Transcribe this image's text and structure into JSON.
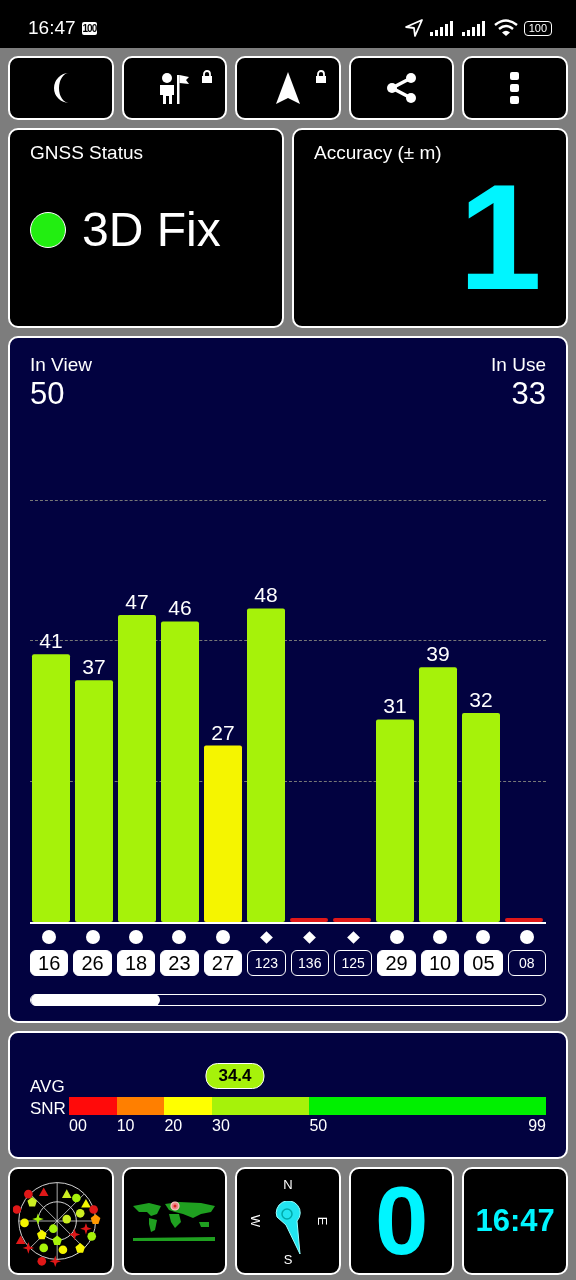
{
  "status_bar": {
    "time": "16:47",
    "badge": "100",
    "battery": "100"
  },
  "toolbar": [
    {
      "kind": "moon",
      "locked": false
    },
    {
      "kind": "person-flag",
      "locked": true
    },
    {
      "kind": "arrow",
      "locked": true
    },
    {
      "kind": "share",
      "locked": false
    },
    {
      "kind": "more",
      "locked": false
    }
  ],
  "gnss_status": {
    "title": "GNSS Status",
    "value": "3D Fix",
    "color": "#22ee11"
  },
  "accuracy": {
    "title": "Accuracy (± m)",
    "value": "1"
  },
  "satellites_panel": {
    "in_view_label": "In View",
    "in_view": "50",
    "in_use_label": "In Use",
    "in_use": "33",
    "chart_data": {
      "type": "bar",
      "categories": [
        "16",
        "26",
        "18",
        "23",
        "27",
        "123",
        "136",
        "125",
        "29",
        "10",
        "05",
        "08"
      ],
      "values": [
        41,
        37,
        47,
        46,
        27,
        48,
        0,
        0,
        31,
        39,
        32,
        0
      ],
      "value_labels": [
        "41",
        "37",
        "47",
        "46",
        "27",
        "48",
        null,
        null,
        "31",
        "39",
        "32",
        null
      ]
    },
    "satellites": [
      {
        "color": "#a6f20a",
        "used": true,
        "kind": "circle"
      },
      {
        "color": "#a6f20a",
        "used": true,
        "kind": "circle"
      },
      {
        "color": "#a6f20a",
        "used": true,
        "kind": "circle"
      },
      {
        "color": "#a6f20a",
        "used": true,
        "kind": "circle"
      },
      {
        "color": "#f5f500",
        "used": true,
        "kind": "circle"
      },
      {
        "color": "#a6f20a",
        "used": false,
        "kind": "diamond"
      },
      {
        "color": "#e01818",
        "used": false,
        "kind": "diamond"
      },
      {
        "color": "#e01818",
        "used": false,
        "kind": "diamond"
      },
      {
        "color": "#a6f20a",
        "used": true,
        "kind": "circle"
      },
      {
        "color": "#a6f20a",
        "used": true,
        "kind": "circle"
      },
      {
        "color": "#a6f20a",
        "used": true,
        "kind": "circle"
      },
      {
        "color": "#e01818",
        "used": false,
        "kind": "circle"
      }
    ]
  },
  "snr": {
    "label_1": "AVG",
    "label_2": "SNR",
    "value": "34.4",
    "level": 0.348,
    "segments": [
      {
        "color": "#ff0a0a"
      },
      {
        "color": "#ff7f00"
      },
      {
        "color": "#ffff00"
      },
      {
        "color": "#a6f20a"
      },
      {
        "color": "#00f000"
      }
    ],
    "ticks": [
      {
        "label": "00"
      },
      {
        "label": "10"
      },
      {
        "label": "20"
      },
      {
        "label": "30"
      },
      {
        "label": "50"
      },
      {
        "label": "99"
      }
    ]
  },
  "tiles": {
    "compass": {
      "north": "N",
      "west": "W",
      "east": "E",
      "south": "S"
    },
    "speed": "0",
    "clock": "16:47"
  }
}
